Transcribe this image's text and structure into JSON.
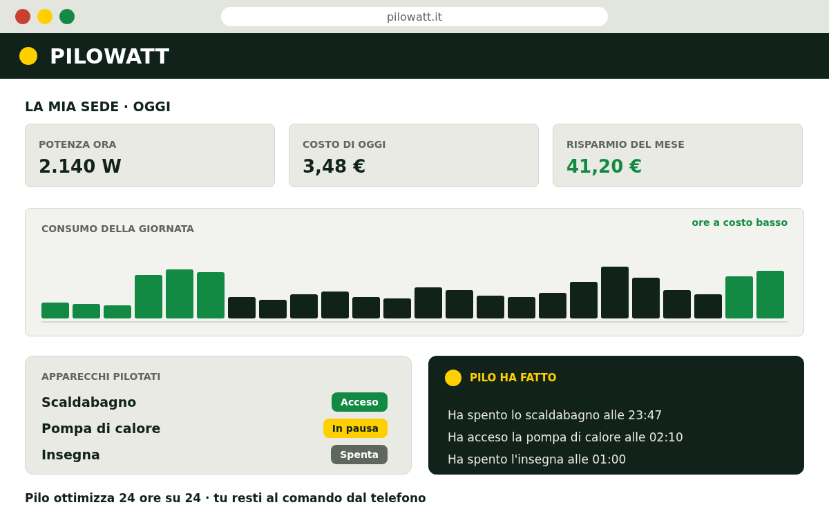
{
  "browser": {
    "url": "pilowatt.it"
  },
  "header": {
    "brand": "PILOWATT"
  },
  "page_title": "LA MIA SEDE · OGGI",
  "stats": [
    {
      "label": "POTENZA ORA",
      "value": "2.140 W",
      "kind": "plain"
    },
    {
      "label": "COSTO DI OGGI",
      "value": "3,48 €",
      "kind": "plain"
    },
    {
      "label": "RISPARMIO DEL MESE",
      "value": "41,20 €",
      "kind": "saving"
    }
  ],
  "chart": {
    "title": "CONSUMO DELLA GIORNATA",
    "legend": "ore a costo basso",
    "bars": [
      {
        "low_cost": true
      },
      {
        "low_cost": true
      },
      {
        "low_cost": true
      },
      {
        "low_cost": true
      },
      {
        "low_cost": true
      },
      {
        "low_cost": true
      },
      {
        "low_cost": false
      },
      {
        "low_cost": false
      },
      {
        "low_cost": false
      },
      {
        "low_cost": false
      },
      {
        "low_cost": false
      },
      {
        "low_cost": false
      },
      {
        "low_cost": false
      },
      {
        "low_cost": false
      },
      {
        "low_cost": false
      },
      {
        "low_cost": false
      },
      {
        "low_cost": false
      },
      {
        "low_cost": false
      },
      {
        "low_cost": false
      },
      {
        "low_cost": false
      },
      {
        "low_cost": false
      },
      {
        "low_cost": false
      },
      {
        "low_cost": true
      },
      {
        "low_cost": true
      }
    ]
  },
  "devices": {
    "title": "APPARECCHI PILOTATI",
    "items": [
      {
        "name": "Scaldabagno",
        "status": "Acceso",
        "kind": "on"
      },
      {
        "name": "Pompa di calore",
        "status": "In pausa",
        "kind": "paused"
      },
      {
        "name": "Insegna",
        "status": "Spenta",
        "kind": "off"
      }
    ]
  },
  "activity": {
    "title": "PILO HA FATTO",
    "entries": [
      "Ha spento lo scaldabagno alle 23:47",
      "Ha acceso la pompa di calore alle 02:10",
      "Ha spento l'insegna alle 01:00"
    ]
  },
  "footer": "Pilo ottimizza 24 ore su 24 · tu resti al comando dal telefono"
}
